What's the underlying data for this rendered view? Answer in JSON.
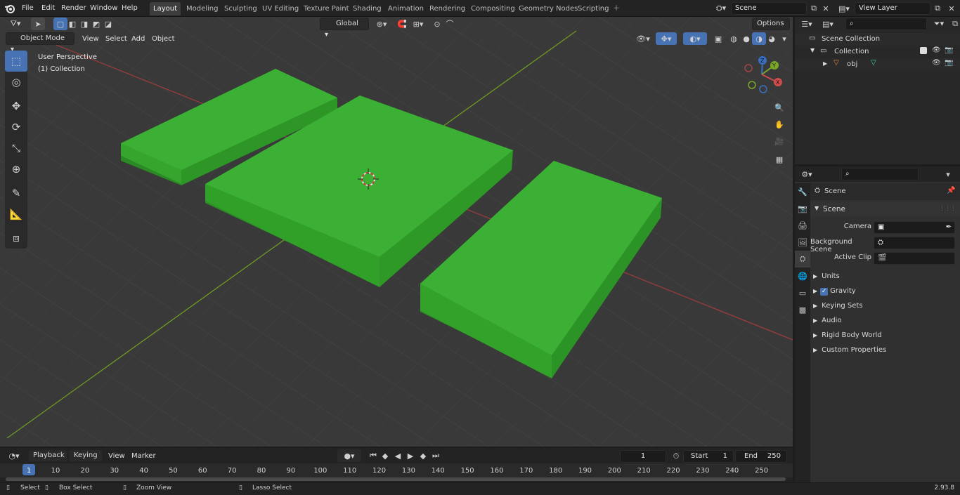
{
  "menu": {
    "file": "File",
    "edit": "Edit",
    "render": "Render",
    "window": "Window",
    "help": "Help"
  },
  "workspaces": [
    "Layout",
    "Modeling",
    "Sculpting",
    "UV Editing",
    "Texture Paint",
    "Shading",
    "Animation",
    "Rendering",
    "Compositing",
    "Geometry Nodes",
    "Scripting"
  ],
  "active_workspace": "Layout",
  "scene_field": "Scene",
  "view_layer_field": "View Layer",
  "viewport_header": {
    "mode": "Object Mode",
    "view": "View",
    "select": "Select",
    "add": "Add",
    "object": "Object",
    "transform": "Global",
    "options": "Options"
  },
  "viewport_overlay": {
    "perspective": "User Perspective",
    "collection": "(1) Collection"
  },
  "navigation_gizmo": {
    "z": "Z",
    "y": "Y",
    "x": "X"
  },
  "outliner": {
    "scene_collection": "Scene Collection",
    "collection": "Collection",
    "object": "obj"
  },
  "properties": {
    "context": "Scene",
    "panel": "Scene",
    "camera_label": "Camera",
    "background_scene_label": "Background Scene",
    "active_clip_label": "Active Clip",
    "sections": [
      "Units",
      "Gravity",
      "Keying Sets",
      "Audio",
      "Rigid Body World",
      "Custom Properties"
    ],
    "gravity_checked": true
  },
  "timeline": {
    "playback": "Playback",
    "keying": "Keying",
    "view": "View",
    "marker": "Marker",
    "current_frame": "1",
    "start_label": "Start",
    "start_value": "1",
    "end_label": "End",
    "end_value": "250",
    "ruler": [
      "1",
      "10",
      "20",
      "30",
      "40",
      "50",
      "60",
      "70",
      "80",
      "90",
      "100",
      "110",
      "120",
      "130",
      "140",
      "150",
      "160",
      "170",
      "180",
      "190",
      "200",
      "210",
      "220",
      "230",
      "240",
      "250"
    ]
  },
  "statusbar": {
    "select": "Select",
    "box_select": "Box Select",
    "zoom_view": "Zoom View",
    "lasso_select": "Lasso Select",
    "version": "2.93.8"
  },
  "colors": {
    "accent": "#4772b3",
    "mat_green": "#3cb034",
    "x_axis": "#b84a4a",
    "y_axis": "#7aa826"
  }
}
